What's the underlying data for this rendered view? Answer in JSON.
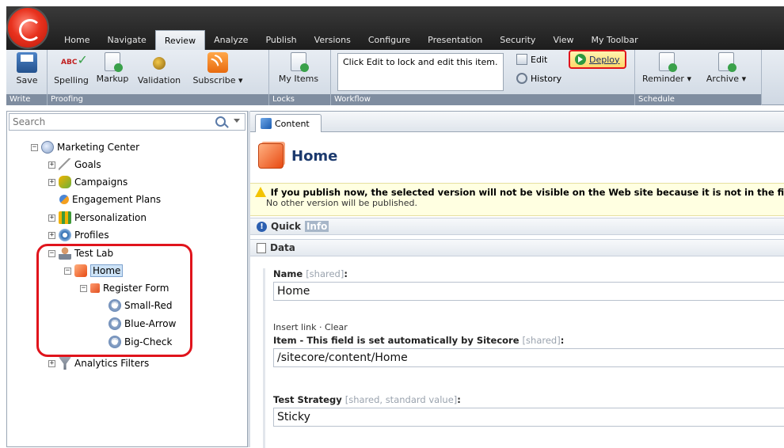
{
  "ribbon_tabs": [
    "Home",
    "Navigate",
    "Review",
    "Analyze",
    "Publish",
    "Versions",
    "Configure",
    "Presentation",
    "Security",
    "View",
    "My Toolbar"
  ],
  "active_tab": "Review",
  "groups": {
    "write": {
      "name": "Write",
      "save": "Save"
    },
    "proofing": {
      "name": "Proofing",
      "spelling": "Spelling",
      "markup": "Markup",
      "validation": "Validation",
      "subscribe": "Subscribe"
    },
    "locks": {
      "name": "Locks",
      "my_items": "My Items"
    },
    "workflow": {
      "name": "Workflow",
      "notice": "Click Edit to lock and edit this item.",
      "edit": "Edit",
      "history": "History",
      "deploy": "Deploy"
    },
    "schedule": {
      "name": "Schedule",
      "reminder": "Reminder",
      "archive": "Archive"
    }
  },
  "search": {
    "placeholder": "Search"
  },
  "tree": {
    "marketing_center": "Marketing Center",
    "goals": "Goals",
    "campaigns": "Campaigns",
    "engagement_plans": "Engagement Plans",
    "personalization": "Personalization",
    "profiles": "Profiles",
    "test_lab": "Test Lab",
    "home": "Home",
    "register_form": "Register Form",
    "small_red": "Small-Red",
    "blue_arrow": "Blue-Arrow",
    "big_check": "Big-Check",
    "analytics_filters": "Analytics Filters"
  },
  "content": {
    "tab": "Content",
    "title": "Home",
    "warning_title": "If you publish now, the selected version will not be visible on the Web site because it is not in the final workflow step.",
    "warning_sub": "No other version will be published.",
    "quick_prefix": "Quick",
    "quick_info": "Info",
    "data_section": "Data"
  },
  "fields": {
    "name": {
      "label": "Name",
      "meta": "[shared]",
      "colon": ":",
      "value": "Home"
    },
    "item": {
      "links": "Insert link · Clear",
      "label": "Item - This field is set automatically by Sitecore",
      "meta": "[shared]",
      "colon": ":",
      "value": "/sitecore/content/Home"
    },
    "strategy": {
      "label": "Test Strategy",
      "meta": "[shared, standard value]",
      "colon": ":",
      "value": "Sticky"
    }
  },
  "colors": {
    "highlight": "#e0141c",
    "title": "#1c3a6e"
  }
}
